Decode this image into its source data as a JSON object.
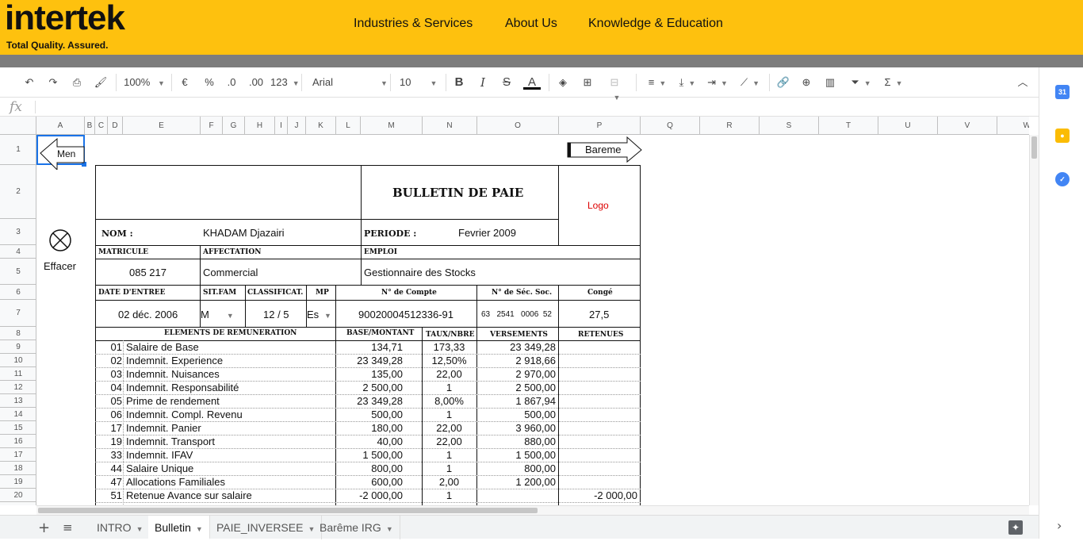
{
  "banner": {
    "logo": "intertek",
    "tagline": "Total Quality. Assured.",
    "nav": [
      "Industries & Services",
      "About Us",
      "Knowledge & Education"
    ],
    "bg": "#fec10e"
  },
  "toolbar": {
    "zoom": "100%",
    "currency": "€",
    "percent": "%",
    "dec_less": ".0",
    "dec_more": ".00",
    "format": "123",
    "font": "Arial",
    "size": "10",
    "bold": "B",
    "italic": "I",
    "strike": "S",
    "textcolor": "A",
    "sigma": "Σ"
  },
  "formula": {
    "fx": "fx"
  },
  "columns": [
    "A",
    "B",
    "C",
    "D",
    "E",
    "F",
    "G",
    "H",
    "I",
    "J",
    "K",
    "L",
    "M",
    "N",
    "O",
    "P",
    "Q",
    "R",
    "S",
    "T",
    "U",
    "V",
    "W"
  ],
  "rows": [
    "1",
    "2",
    "3",
    "4",
    "5",
    "6",
    "7",
    "8",
    "9",
    "10",
    "11",
    "12",
    "13",
    "14",
    "15",
    "16",
    "17",
    "18",
    "19",
    "20"
  ],
  "sheet": {
    "men": "Men",
    "bareme": "Bareme",
    "effacer": "Effacer",
    "title": "BULLETIN DE PAIE",
    "logo": "Logo",
    "nom_label": "NOM :",
    "nom": "KHADAM  Djazairi",
    "periode_label": "PERIODE  :",
    "periode": "Fevrier 2009",
    "matricule_label": "MATRICULE",
    "affectation_label": "AFFECTATION",
    "emploi_label": "EMPLOI",
    "matricule": "085 217",
    "affectation": "Commercial",
    "emploi": "Gestionnaire des Stocks",
    "date_label": "DATE D'ENTREE",
    "sitfam_label": "SIT.FAM",
    "classif_label": "CLASSIFICAT.",
    "mp_label": "MP",
    "compte_label": "N° de Compte",
    "secsoc_label": "N° de Séc. Soc.",
    "conge_label": "Congé",
    "date": "02 déc. 2006",
    "sitfam": "M",
    "classif": "12  /  5",
    "mp": "Esp",
    "compte": "90020004512336-91",
    "secsoc": "63   2541   0006  52",
    "conge": "27,5",
    "h_elements": "ELEMENTS DE REMUNERATION",
    "h_base": "BASE/MONTANT",
    "h_taux": "TAUX/NBRE",
    "h_vers": "VERSEMENTS",
    "h_ret": "RETENUES",
    "lines": [
      {
        "code": "01",
        "label": "Salaire de Base",
        "base": "134,71",
        "taux": "173,33",
        "vers": "23 349,28",
        "ret": ""
      },
      {
        "code": "02",
        "label": "Indemnit. Experience",
        "base": "23 349,28",
        "taux": "12,50%",
        "vers": "2 918,66",
        "ret": ""
      },
      {
        "code": "03",
        "label": "Indemnit. Nuisances",
        "base": "135,00",
        "taux": "22,00",
        "vers": "2 970,00",
        "ret": ""
      },
      {
        "code": "04",
        "label": "Indemnit. Responsabilité",
        "base": "2 500,00",
        "taux": "1",
        "vers": "2 500,00",
        "ret": ""
      },
      {
        "code": "05",
        "label": "Prime de rendement",
        "base": "23 349,28",
        "taux": "8,00%",
        "vers": "1 867,94",
        "ret": ""
      },
      {
        "code": "06",
        "label": "Indemnit. Compl. Revenu",
        "base": "500,00",
        "taux": "1",
        "vers": "500,00",
        "ret": ""
      },
      {
        "code": "17",
        "label": "Indemnit. Panier",
        "base": "180,00",
        "taux": "22,00",
        "vers": "3 960,00",
        "ret": ""
      },
      {
        "code": "19",
        "label": "Indemnit. Transport",
        "base": "40,00",
        "taux": "22,00",
        "vers": "880,00",
        "ret": ""
      },
      {
        "code": "33",
        "label": "Indemnit. IFAV",
        "base": "1 500,00",
        "taux": "1",
        "vers": "1 500,00",
        "ret": ""
      },
      {
        "code": "44",
        "label": "Salaire Unique",
        "base": "800,00",
        "taux": "1",
        "vers": "800,00",
        "ret": ""
      },
      {
        "code": "47",
        "label": "Allocations Familiales",
        "base": "600,00",
        "taux": "2,00",
        "vers": "1 200,00",
        "ret": ""
      },
      {
        "code": "51",
        "label": "Retenue Avance sur salaire",
        "base": "-2 000,00",
        "taux": "1",
        "vers": "",
        "ret": "-2 000,00"
      }
    ]
  },
  "tabs": [
    {
      "label": "INTRO"
    },
    {
      "label": "Bulletin"
    },
    {
      "label": "PAIE_INVERSEE"
    },
    {
      "label": "Barême IRG"
    }
  ]
}
